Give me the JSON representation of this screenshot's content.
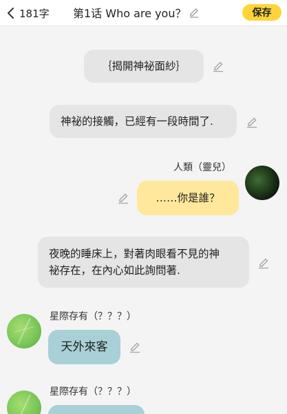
{
  "header": {
    "word_count": "181字",
    "title": "第1话 Who are you？",
    "save_label": "保存"
  },
  "messages": {
    "chapter_heading": "｛揭開神祕面紗｝",
    "narration_1": "神祕的接觸，已經有一段時間了.",
    "user_name": "人類（靈兒）",
    "user_msg": "……你是誰？",
    "narration_2_line1": "夜晚的睡床上，對著肉眼看不見的神",
    "narration_2_line2": "祕存在，在內心如此詢問著.",
    "other_name_1": "星際存有（？？？）",
    "other_msg_1": "天外來客",
    "other_name_2": "星際存有（？？？）"
  },
  "colors": {
    "accent": "#ffd43b",
    "user_bubble": "#ffe89c",
    "other_bubble": "#a8d0d6",
    "narration_bubble": "#e5e5e5"
  }
}
